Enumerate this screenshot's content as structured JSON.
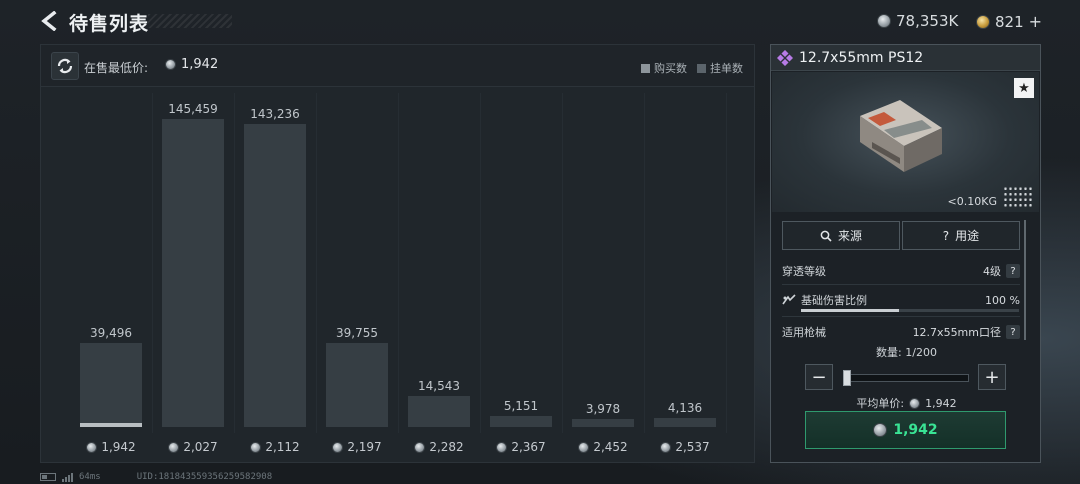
{
  "header": {
    "title": "待售列表",
    "silver_balance": "78,353K",
    "gold_balance": "821",
    "gold_add": "+"
  },
  "chart_panel": {
    "min_price_label": "在售最低价:",
    "min_price_value": "1,942",
    "legend_buy": "购买数",
    "legend_sell": "挂单数"
  },
  "chart_data": {
    "type": "bar",
    "categories": [
      "1,942",
      "2,027",
      "2,112",
      "2,197",
      "2,282",
      "2,367",
      "2,452",
      "2,537"
    ],
    "series": [
      {
        "name": "挂单数",
        "values": [
          39496,
          145459,
          143236,
          39755,
          14543,
          5151,
          3978,
          4136
        ]
      },
      {
        "name": "购买数",
        "values": [
          1800,
          0,
          0,
          0,
          0,
          0,
          0,
          0
        ]
      }
    ],
    "value_labels": [
      "39,496",
      "145,459",
      "143,236",
      "39,755",
      "14,543",
      "5,151",
      "3,978",
      "4,136"
    ],
    "legend_position": "top-right",
    "grid": true
  },
  "item": {
    "name": "12.7x55mm PS12",
    "weight": "<0.10KG",
    "fav_icon": "★",
    "source_label": "来源",
    "usage_label": "用途",
    "stats": [
      {
        "label": "穿透等级",
        "value": "4级"
      },
      {
        "label": "基础伤害比例",
        "value": "100 %",
        "level": 0.45
      },
      {
        "label": "适用枪械",
        "value": "12.7x55mm口径"
      }
    ],
    "quantity_label": "数量:",
    "quantity_value": "1/200",
    "unit_price_label": "平均单价:",
    "unit_price_value": "1,942",
    "buy_price": "1,942",
    "minus": "−",
    "plus": "+"
  },
  "footer": {
    "ping": "64ms",
    "uid": "UID:181843559356259582908"
  },
  "colors": {
    "accent_green": "#39e394",
    "buy_border": "#2f9a6e",
    "bar": "#363e44",
    "buy_bar": "#b9bec2"
  }
}
